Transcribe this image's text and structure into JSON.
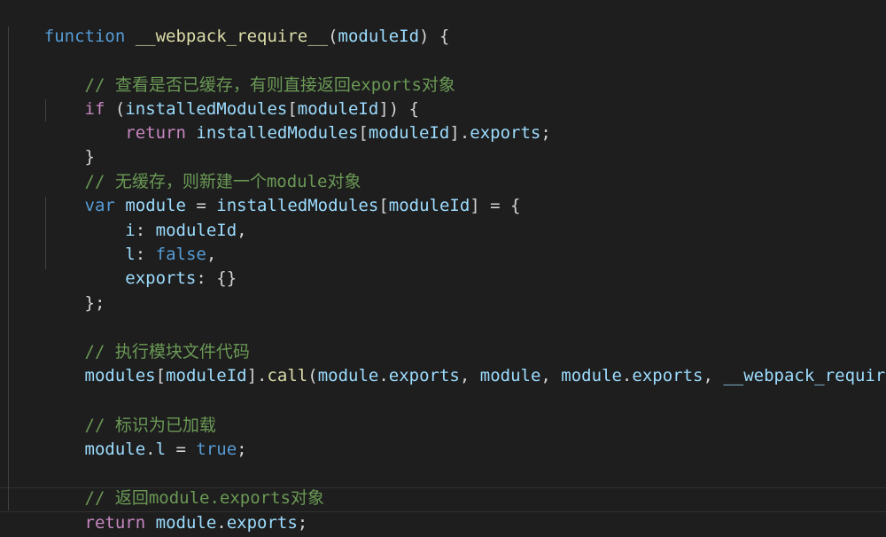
{
  "editor": {
    "code": {
      "l1": {
        "kw": "function",
        "sp": " ",
        "name": "__webpack_require__",
        "open": "(",
        "param": "moduleId",
        "close": ") {"
      },
      "l3": {
        "indent": "    ",
        "text": "// 查看是否已缓存，有则直接返回exports对象"
      },
      "l4": {
        "indent": "    ",
        "kw": "if",
        "p1": " (",
        "obj": "installedModules",
        "b1": "[",
        "key": "moduleId",
        "b2": "]) {"
      },
      "l5": {
        "indent": "        ",
        "kw": "return",
        "sp": " ",
        "obj": "installedModules",
        "b1": "[",
        "key": "moduleId",
        "b2": "].",
        "prop": "exports",
        "end": ";"
      },
      "l6": {
        "indent": "    ",
        "text": "}"
      },
      "l7": {
        "indent": "    ",
        "text": "// 无缓存，则新建一个module对象"
      },
      "l8": {
        "indent": "    ",
        "kw": "var",
        "sp": " ",
        "name": "module",
        "eq": " = ",
        "obj": "installedModules",
        "b1": "[",
        "key": "moduleId",
        "b2": "] = {"
      },
      "l9": {
        "indent": "        ",
        "key": "i",
        "colon": ": ",
        "val": "moduleId",
        "end": ","
      },
      "l10": {
        "indent": "        ",
        "key": "l",
        "colon": ": ",
        "val": "false",
        "end": ","
      },
      "l11": {
        "indent": "        ",
        "key": "exports",
        "colon": ": ",
        "val": "{}"
      },
      "l12": {
        "indent": "    ",
        "text": "};"
      },
      "l14": {
        "indent": "    ",
        "text": "// 执行模块文件代码"
      },
      "l15": {
        "indent": "    ",
        "obj": "modules",
        "b1": "[",
        "key": "moduleId",
        "b2": "].",
        "fn": "call",
        "p1": "(",
        "a1": "module",
        "d1": ".",
        "a1p": "exports",
        "c1": ", ",
        "a2": "module",
        "c2": ", ",
        "a3": "module",
        "d3": ".",
        "a3p": "exports",
        "c3": ", ",
        "a4": "__webpack_require__",
        "end": ");"
      },
      "l17": {
        "indent": "    ",
        "text": "// 标识为已加载"
      },
      "l18": {
        "indent": "    ",
        "obj": "module",
        "dot": ".",
        "prop": "l",
        "eq": " = ",
        "val": "true",
        "end": ";"
      },
      "l20": {
        "indent": "    ",
        "text": "// 返回module.exports对象"
      },
      "l21": {
        "indent": "    ",
        "kw": "return",
        "sp": " ",
        "obj": "module",
        "dot": ".",
        "prop": "exports",
        "end": ";"
      },
      "l22": {
        "text": "}"
      }
    },
    "colors": {
      "background": "#1e1e1e",
      "keyword": "#569cd6",
      "control_keyword": "#c586c0",
      "function": "#dcdcaa",
      "variable": "#9cdcfe",
      "comment": "#6a9955",
      "text": "#d4d4d4"
    }
  }
}
